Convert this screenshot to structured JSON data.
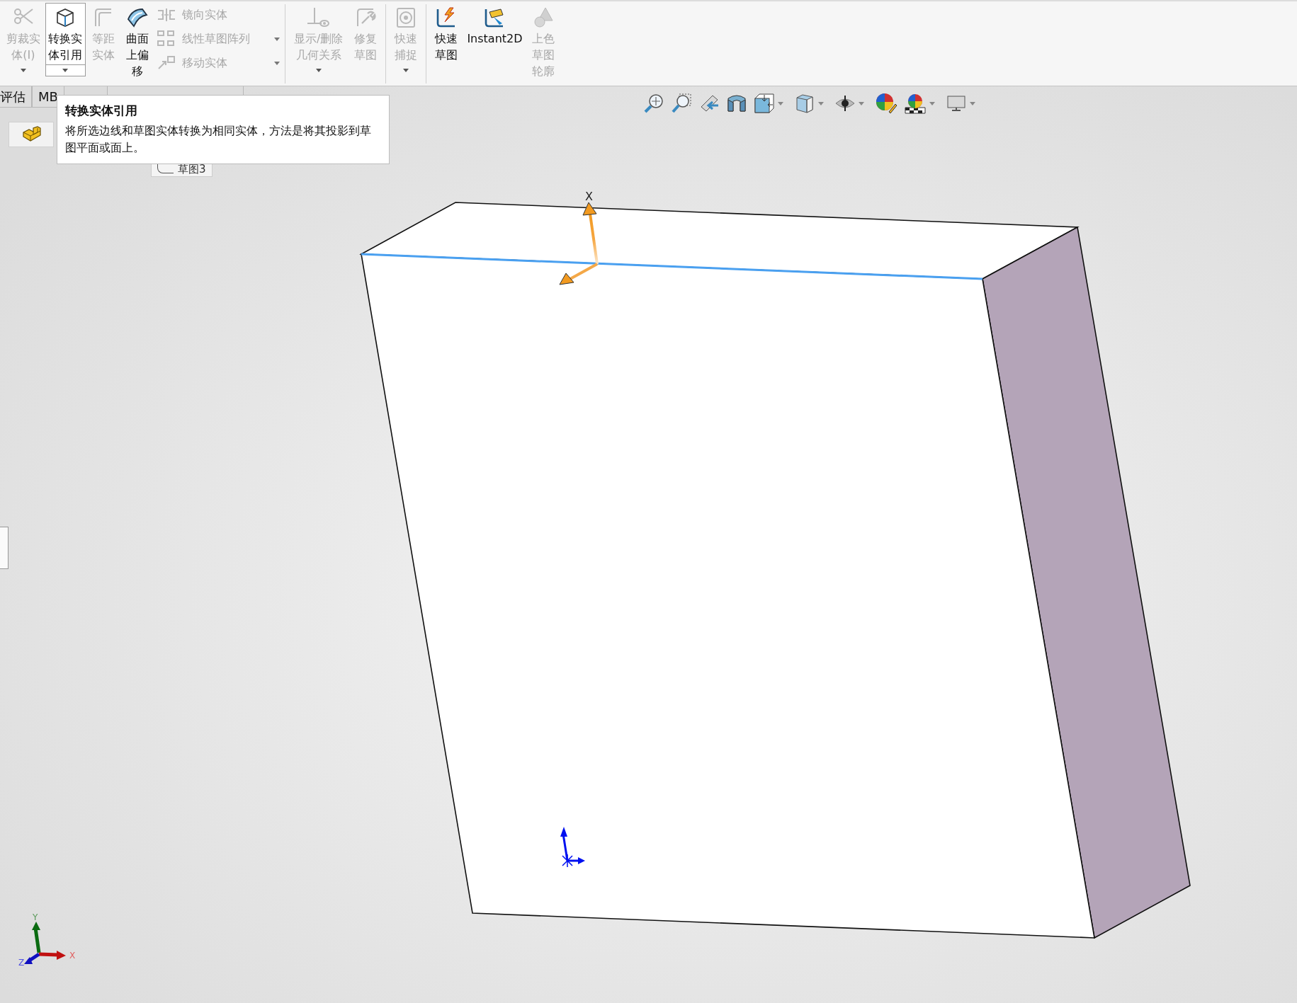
{
  "command_manager": {
    "groups": [
      {
        "buttons": [
          {
            "label": "剪裁实体(I)",
            "disabled": true,
            "selected": false,
            "dropdown": true
          },
          {
            "label": "转换实体引用",
            "disabled": false,
            "selected": true,
            "dropdown": true
          },
          {
            "label": "等距实体",
            "disabled": true,
            "selected": false,
            "dropdown": false
          },
          {
            "label": "曲面上偏移",
            "disabled": false,
            "selected": false,
            "dropdown": false
          }
        ],
        "small_buttons": [
          {
            "label": "镜向实体",
            "disabled": true,
            "dropdown": false
          },
          {
            "label": "线性草图阵列",
            "disabled": true,
            "dropdown": true
          },
          {
            "label": "移动实体",
            "disabled": true,
            "dropdown": true
          }
        ]
      },
      {
        "buttons": [
          {
            "label": "显示/删除几何关系",
            "disabled": true,
            "selected": false,
            "dropdown": true
          },
          {
            "label": "修复草图",
            "disabled": true,
            "selected": false,
            "dropdown": false
          }
        ]
      },
      {
        "buttons": [
          {
            "label": "快速捕捉",
            "disabled": true,
            "selected": false,
            "dropdown": true
          }
        ]
      },
      {
        "buttons": [
          {
            "label": "快速草图",
            "disabled": false,
            "selected": false,
            "dropdown": false
          },
          {
            "label": "Instant2D",
            "disabled": false,
            "selected": false,
            "dropdown": false
          },
          {
            "label": "上色草图轮廓",
            "disabled": true,
            "selected": false,
            "dropdown": false
          }
        ]
      }
    ]
  },
  "tabs": [
    {
      "label": "评估"
    },
    {
      "label": "MB"
    }
  ],
  "tooltip": {
    "title": "转换实体引用",
    "text": "将所选边线和草图实体转换为相同实体，方法是将其投影到草图平面或面上。"
  },
  "feature_tree": {
    "sketch_label": "草图3"
  },
  "viewport": {
    "sketch_axis_label": "X",
    "triad": {
      "y": "Y",
      "x": "X",
      "z": "Z"
    }
  }
}
